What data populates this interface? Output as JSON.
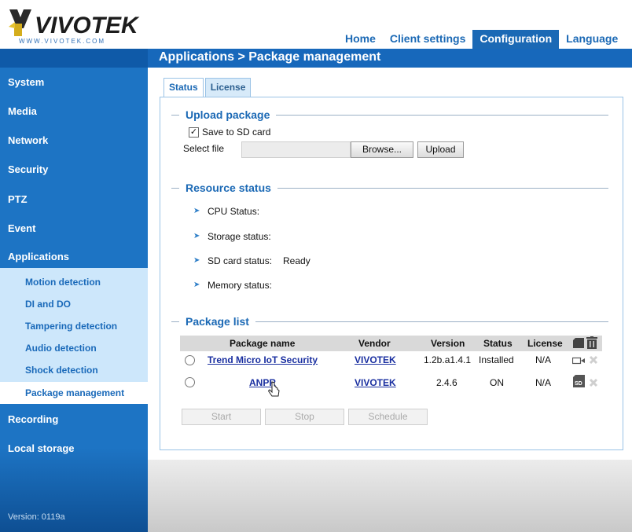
{
  "brand": {
    "name": "VIVOTEK",
    "tagline": "WWW.VIVOTEK.COM"
  },
  "nav": {
    "items": [
      "Home",
      "Client settings",
      "Configuration",
      "Language"
    ],
    "active_index": 2
  },
  "breadcrumb": "Applications > Package management",
  "sidebar": {
    "items": [
      "System",
      "Media",
      "Network",
      "Security",
      "PTZ",
      "Event",
      "Applications"
    ],
    "sub_items": [
      "Motion detection",
      "DI and DO",
      "Tampering detection",
      "Audio detection",
      "Shock detection",
      "Package management"
    ],
    "active_sub": "Package management",
    "after_items": [
      "Recording",
      "Local storage"
    ],
    "version": "Version: 0119a"
  },
  "tabs": [
    "Status",
    "License"
  ],
  "upload": {
    "title": "Upload package",
    "save_to_sd_label": "Save to SD card",
    "save_to_sd_checked": true,
    "select_file_label": "Select file",
    "browse_label": "Browse...",
    "upload_label": "Upload"
  },
  "resource": {
    "title": "Resource status",
    "items": [
      {
        "label": "CPU Status:",
        "value": ""
      },
      {
        "label": "Storage status:",
        "value": ""
      },
      {
        "label": "SD card status:",
        "value": "Ready"
      },
      {
        "label": "Memory status:",
        "value": ""
      }
    ]
  },
  "packages": {
    "title": "Package list",
    "columns": [
      "Package name",
      "Vendor",
      "Version",
      "Status",
      "License"
    ],
    "rows": [
      {
        "name": "Trend Micro IoT Security",
        "vendor": "VIVOTEK",
        "version": "1.2b.a1.4.1",
        "status": "Installed",
        "license": "N/A",
        "type_icon": "camera-icon"
      },
      {
        "name": "ANPR",
        "vendor": "VIVOTEK",
        "version": "2.4.6",
        "status": "ON",
        "license": "N/A",
        "type_icon": "sd-card-icon"
      }
    ],
    "buttons": [
      "Start",
      "Stop",
      "Schedule"
    ]
  },
  "colors": {
    "accent": "#1b69b5",
    "sidebar": "#1d74c4",
    "link": "#1a2fa0"
  }
}
